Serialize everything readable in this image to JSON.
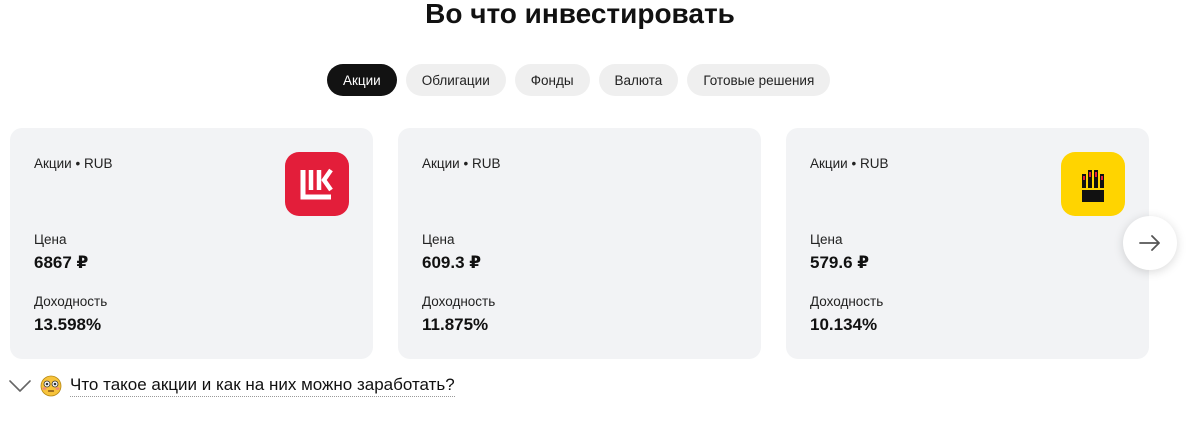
{
  "heading": "Во что инвестировать",
  "tabs": [
    {
      "label": "Акции",
      "active": true
    },
    {
      "label": "Облигации",
      "active": false
    },
    {
      "label": "Фонды",
      "active": false
    },
    {
      "label": "Валюта",
      "active": false
    },
    {
      "label": "Готовые решения",
      "active": false
    }
  ],
  "cards": [
    {
      "meta": "Акции • RUB",
      "price_label": "Цена",
      "price": "6867 ₽",
      "yield_label": "Доходность",
      "yield": "13.598%",
      "logo": "lukoil-logo",
      "logo_color": "#e31e3a"
    },
    {
      "meta": "Акции • RUB",
      "price_label": "Цена",
      "price": "609.3 ₽",
      "yield_label": "Доходность",
      "yield": "11.875%",
      "logo": "",
      "logo_color": ""
    },
    {
      "meta": "Акции • RUB",
      "price_label": "Цена",
      "price": "579.6 ₽",
      "yield_label": "Доходность",
      "yield": "10.134%",
      "logo": "rosneft-logo",
      "logo_color": "#ffd400"
    }
  ],
  "next_button_icon": "arrow-right-icon",
  "faq": {
    "icon": "chevron-down-icon",
    "emoji": "flushed-face-emoji",
    "text": "Что такое акции и как на них можно заработать?"
  }
}
